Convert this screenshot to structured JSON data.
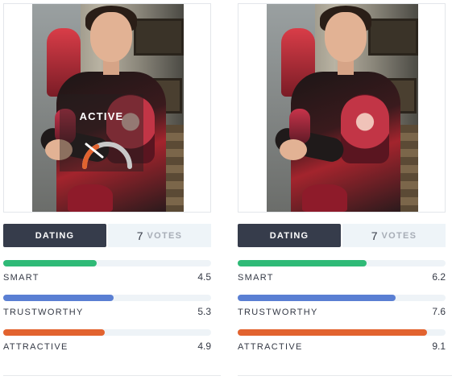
{
  "cards": [
    {
      "overlay": {
        "label": "ACTIVE",
        "gauge_progress": 0.35
      },
      "tabs": {
        "dating_label": "DATING",
        "votes_count": "7",
        "votes_label": "VOTES"
      },
      "metrics": [
        {
          "label": "SMART",
          "score": "4.5",
          "fraction": 0.45,
          "color": "#2fba77"
        },
        {
          "label": "TRUSTWORTHY",
          "score": "5.3",
          "fraction": 0.53,
          "color": "#5a7fd3"
        },
        {
          "label": "ATTRACTIVE",
          "score": "4.9",
          "fraction": 0.49,
          "color": "#e2632f"
        }
      ]
    },
    {
      "tabs": {
        "dating_label": "DATING",
        "votes_count": "7",
        "votes_label": "VOTES"
      },
      "metrics": [
        {
          "label": "SMART",
          "score": "6.2",
          "fraction": 0.62,
          "color": "#2fba77"
        },
        {
          "label": "TRUSTWORTHY",
          "score": "7.6",
          "fraction": 0.76,
          "color": "#5a7fd3"
        },
        {
          "label": "ATTRACTIVE",
          "score": "9.1",
          "fraction": 0.91,
          "color": "#e2632f"
        }
      ]
    }
  ]
}
